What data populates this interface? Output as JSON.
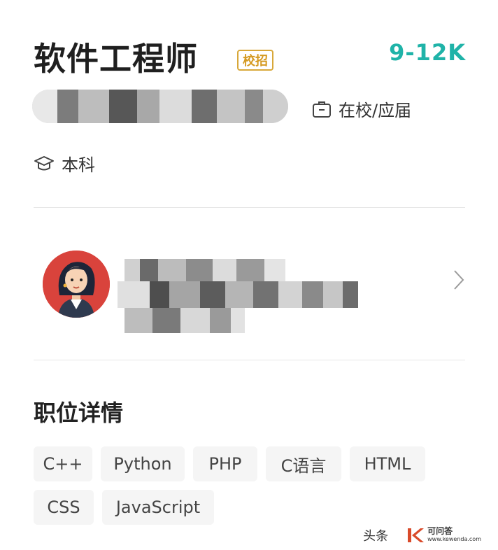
{
  "job": {
    "title": "软件工程师",
    "badge": "校招",
    "salary": "9-12K",
    "status": "在校/应届",
    "education": "本科"
  },
  "details": {
    "section_title": "职位详情",
    "tags": [
      "C++",
      "Python",
      "PHP",
      "C语言",
      "HTML",
      "CSS",
      "JavaScript"
    ]
  },
  "icons": {
    "status": "briefcase-icon",
    "education": "graduation-cap-icon",
    "recruiter_chevron": "chevron-right-icon"
  },
  "watermark": {
    "source": "头条",
    "brand": "可问答",
    "domain": "www.kewenda.com"
  },
  "colors": {
    "salary": "#1fb3a8",
    "badge": "#d59a21",
    "avatar_bg": "#d9433c"
  }
}
